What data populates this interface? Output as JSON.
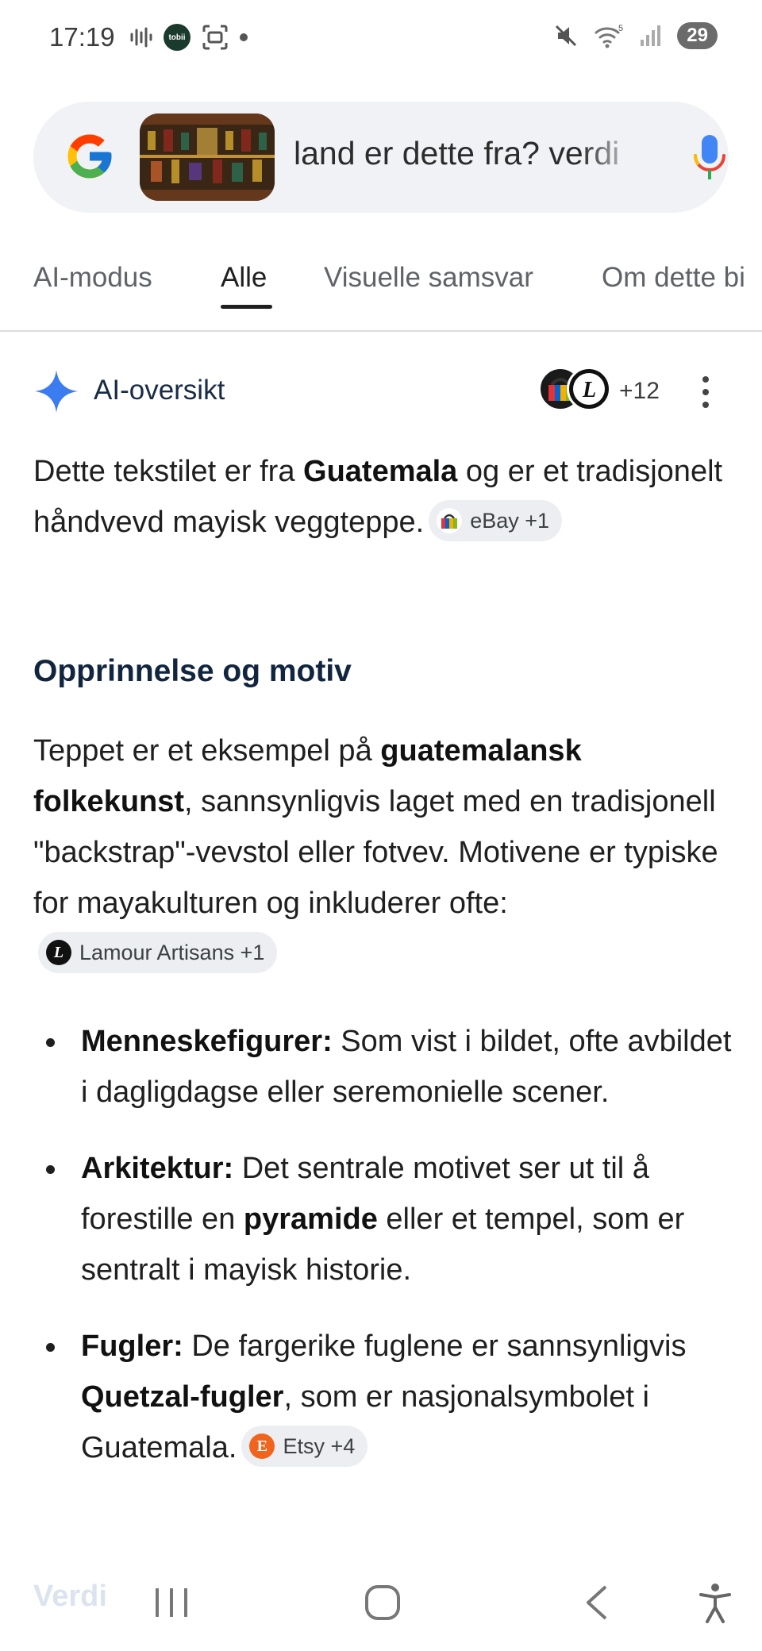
{
  "status": {
    "time": "17:19",
    "battery": "29",
    "tobii_label": "tobii",
    "wifi_badge": "5"
  },
  "search": {
    "query": "land er dette fra? verdi"
  },
  "tabs": [
    {
      "label": "AI-modus"
    },
    {
      "label": "Alle"
    },
    {
      "label": "Visuelle samsvar"
    },
    {
      "label": "Om dette bi"
    }
  ],
  "ai_overview": {
    "title": "AI-oversikt",
    "sources_count": "+12"
  },
  "intro": {
    "part1": "Dette tekstilet er fra ",
    "bold1": "Guatemala",
    "part2": " og er et tradisjonelt håndvevd mayisk veggteppe.",
    "chip": "eBay +1"
  },
  "section": {
    "heading": "Opprinnelse og motiv",
    "part1": "Teppet er et eksempel på ",
    "bold1": "guatemalansk folkekunst",
    "part2": ", sannsynligvis laget med en tradisjonell \"backstrap\"-vevstol eller fotvev. Motivene er typiske for mayakulturen og inkluderer ofte: ",
    "chip": "Lamour Artisans +1"
  },
  "bullets": [
    {
      "title": "Menneskefigurer:",
      "text1": " Som vist i bildet, ofte avbildet i dagligdagse eller seremonielle scener.",
      "bold": "",
      "text2": ""
    },
    {
      "title": "Arkitektur:",
      "text1": " Det sentrale motivet ser ut til å forestille en ",
      "bold": "pyramide",
      "text2": " eller et tempel, som er sentralt i mayisk historie."
    },
    {
      "title": "Fugler:",
      "text1": " De fargerike fuglene er sannsynligvis ",
      "bold": "Quetzal-fugler",
      "text2": ", som er nasjonalsymbolet i Guatemala.",
      "chip": "Etsy +4"
    }
  ],
  "nav": {
    "faded_text": "Verdi"
  },
  "colors": {
    "accent_blue": "#4285f4",
    "chip_bg": "#eceef1",
    "search_bg": "#f0f2f5"
  }
}
